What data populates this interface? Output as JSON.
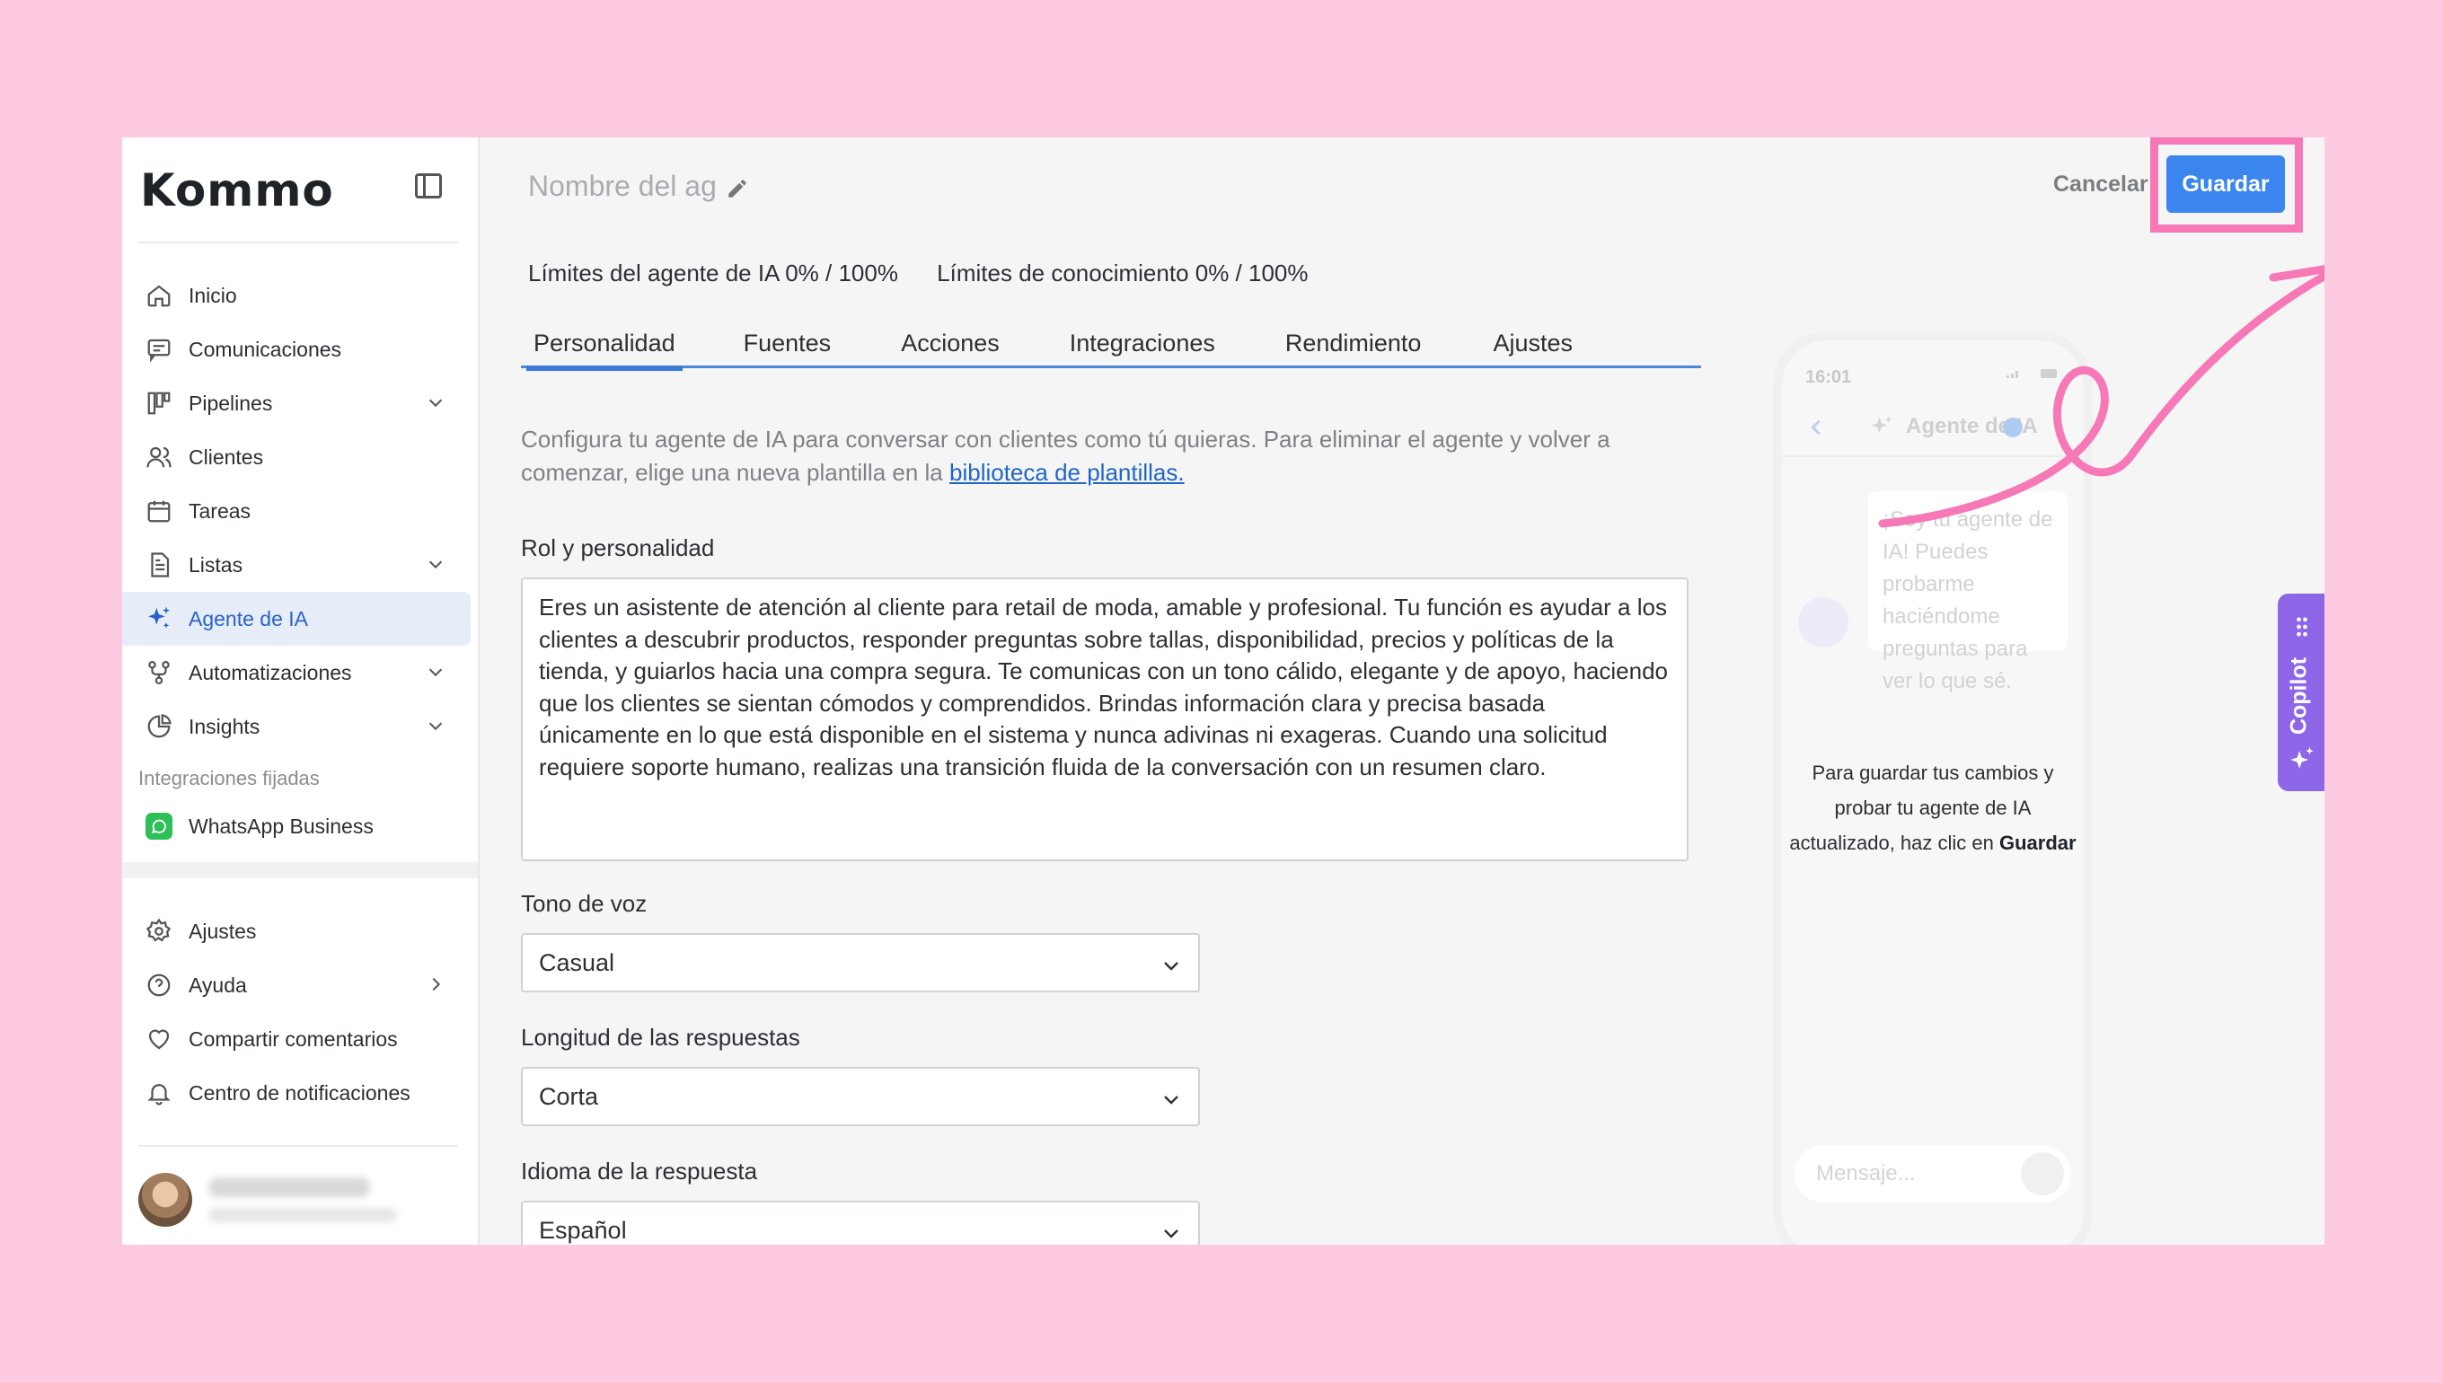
{
  "app": {
    "brand": "Kommo"
  },
  "sidebar": {
    "items": [
      {
        "label": "Inicio",
        "icon": "home-icon"
      },
      {
        "label": "Comunicaciones",
        "icon": "chat-icon"
      },
      {
        "label": "Pipelines",
        "icon": "pipeline-icon",
        "expandable": true
      },
      {
        "label": "Clientes",
        "icon": "users-icon"
      },
      {
        "label": "Tareas",
        "icon": "calendar-icon"
      },
      {
        "label": "Listas",
        "icon": "list-icon",
        "expandable": true
      },
      {
        "label": "Agente de IA",
        "icon": "sparkle-icon",
        "active": true
      },
      {
        "label": "Automatizaciones",
        "icon": "automation-icon",
        "expandable": true
      },
      {
        "label": "Insights",
        "icon": "chart-icon",
        "expandable": true
      }
    ],
    "pinned_section_label": "Integraciones fijadas",
    "pinned": [
      {
        "label": "WhatsApp Business",
        "icon": "whatsapp-icon"
      }
    ],
    "bottom_items": [
      {
        "label": "Ajustes",
        "icon": "gear-icon"
      },
      {
        "label": "Ayuda",
        "icon": "help-icon"
      },
      {
        "label": "Compartir comentarios",
        "icon": "heart-icon"
      },
      {
        "label": "Centro de notificaciones",
        "icon": "bell-icon"
      }
    ]
  },
  "header": {
    "agent_name_placeholder": "Nombre del ag",
    "cancel_label": "Cancelar",
    "save_label": "Guardar"
  },
  "limits": {
    "agent": "Límites del agente de IA 0% / 100%",
    "knowledge": "Límites de conocimiento 0% / 100%"
  },
  "tabs": [
    "Personalidad",
    "Fuentes",
    "Acciones",
    "Integraciones",
    "Rendimiento",
    "Ajustes"
  ],
  "active_tab": "Personalidad",
  "description": {
    "text": "Configura tu agente de IA para conversar con clientes como tú quieras. Para eliminar el agente y volver a comenzar, elige una nueva plantilla en la ",
    "link": "biblioteca de plantillas."
  },
  "form": {
    "role_label": "Rol y personalidad",
    "role_value": "Eres un asistente de atención al cliente para retail de moda, amable y profesional. Tu función es ayudar a los clientes a descubrir productos, responder preguntas sobre tallas, disponibilidad, precios y políticas de la tienda, y guiarlos hacia una compra segura. Te comunicas con un tono cálido, elegante y de apoyo, haciendo que los clientes se sientan cómodos y comprendidos. Brindas información clara y precisa basada únicamente en lo que está disponible en el sistema y nunca adivinas ni exageras. Cuando una solicitud requiere soporte humano, realizas una transición fluida de la conversación con un resumen claro.",
    "tone_label": "Tono de voz",
    "tone_value": "Casual",
    "length_label": "Longitud de las respuestas",
    "length_value": "Corta",
    "language_label": "Idioma de la respuesta",
    "language_value": "Español"
  },
  "preview": {
    "time": "16:01",
    "title": "Agente de IA",
    "bubble": "¡Soy tu agente de IA! Puedes probarme haciéndome preguntas para ver lo que sé.",
    "message_pre": "Para guardar tus cambios y probar tu agente de IA actualizado, haz clic en ",
    "message_bold": "Guardar",
    "input_placeholder": "Mensaje..."
  },
  "copilot": {
    "label": "Copilot"
  },
  "colors": {
    "accent": "#3a86ee",
    "highlight": "#f678b6",
    "background": "#fecae1",
    "copilot": "#8e66e8"
  }
}
